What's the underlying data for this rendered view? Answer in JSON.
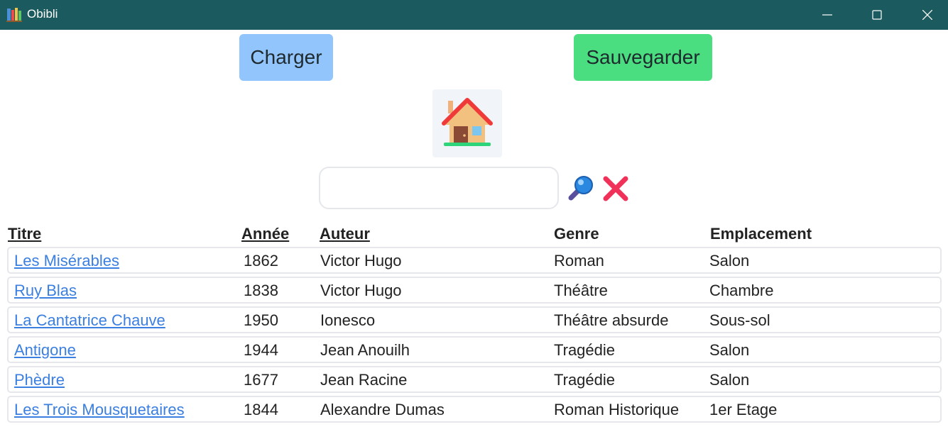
{
  "window": {
    "title": "Obibli",
    "icon": "books-icon"
  },
  "toolbar": {
    "load_label": "Charger",
    "save_label": "Sauvegarder",
    "load_color": "#93c5fd",
    "save_color": "#4ade80",
    "home_icon": "house-icon"
  },
  "search": {
    "value": "",
    "placeholder": "",
    "search_icon": "magnifier-icon",
    "clear_icon": "cross-icon"
  },
  "table": {
    "headers": {
      "title": "Titre",
      "year": "Année",
      "author": "Auteur",
      "genre": "Genre",
      "location": "Emplacement"
    },
    "rows": [
      {
        "title": "Les Misérables",
        "year": "1862",
        "author": "Victor Hugo",
        "genre": "Roman",
        "location": "Salon"
      },
      {
        "title": "Ruy Blas",
        "year": "1838",
        "author": "Victor Hugo",
        "genre": "Théâtre",
        "location": "Chambre"
      },
      {
        "title": "La Cantatrice Chauve",
        "year": "1950",
        "author": "Ionesco",
        "genre": "Théâtre absurde",
        "location": "Sous-sol"
      },
      {
        "title": "Antigone",
        "year": "1944",
        "author": "Jean Anouilh",
        "genre": "Tragédie",
        "location": "Salon"
      },
      {
        "title": "Phèdre",
        "year": "1677",
        "author": "Jean Racine",
        "genre": "Tragédie",
        "location": "Salon"
      },
      {
        "title": "Les Trois Mousquetaires",
        "year": "1844",
        "author": "Alexandre Dumas",
        "genre": "Roman Historique",
        "location": "1er Etage"
      }
    ]
  },
  "colors": {
    "titlebar": "#1b5a5e",
    "link": "#3b7fe0"
  }
}
